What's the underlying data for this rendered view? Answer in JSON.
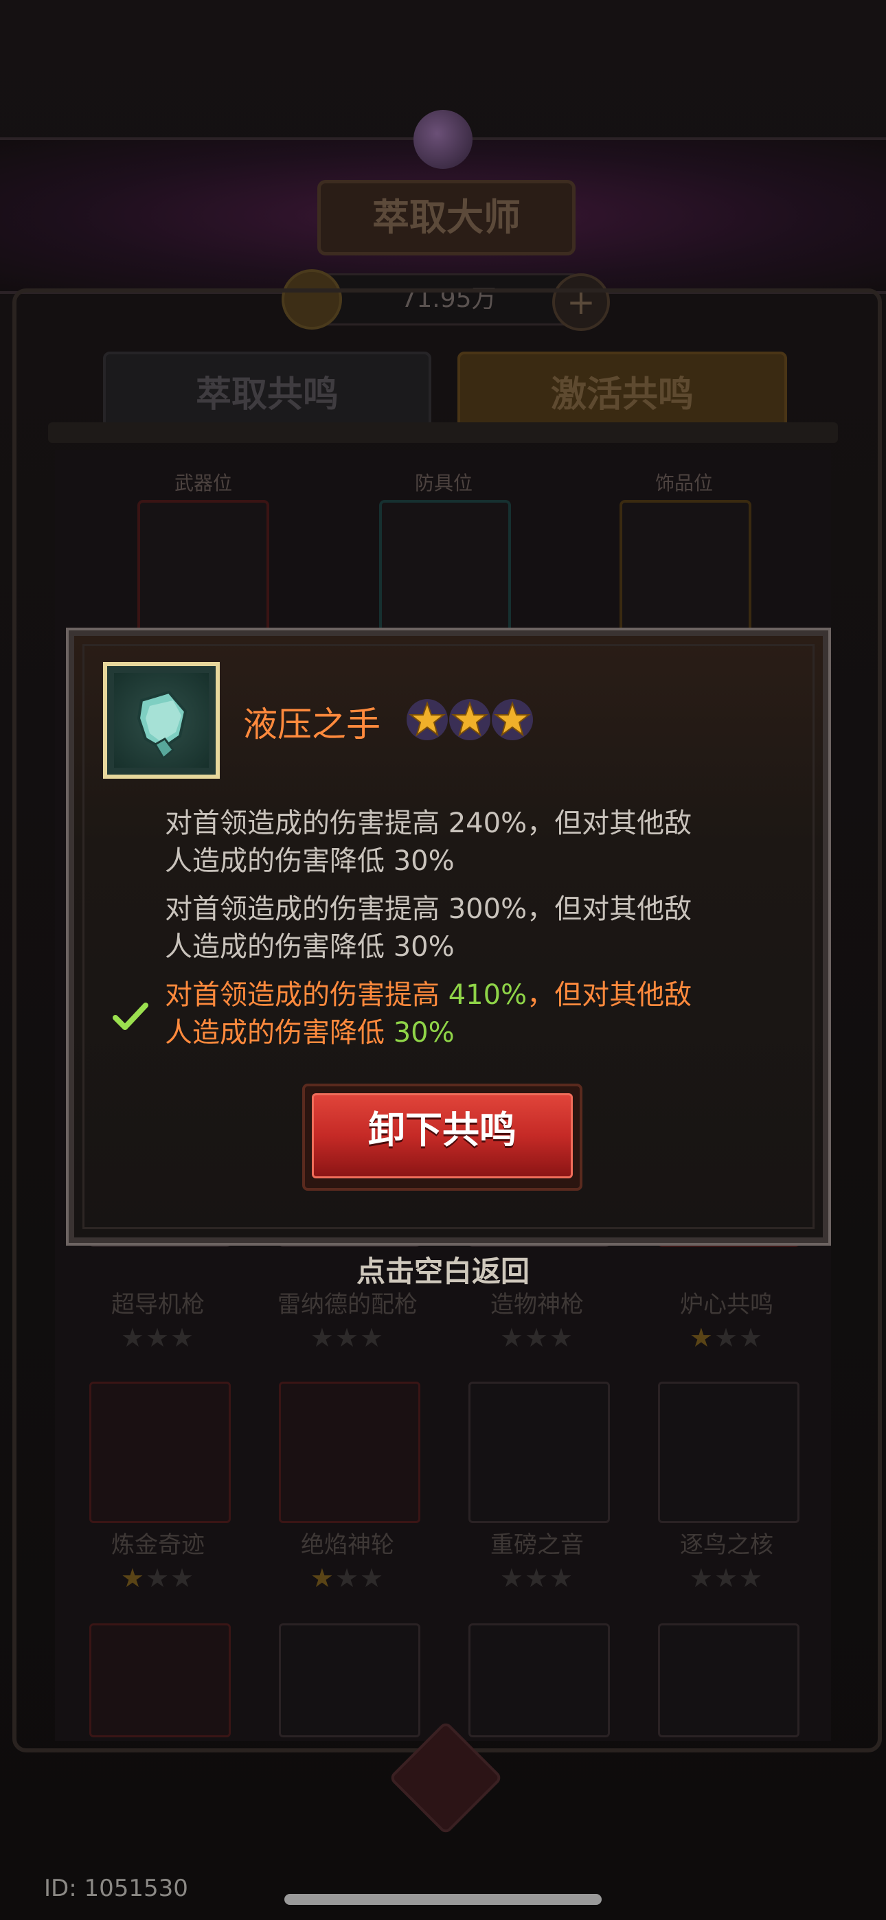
{
  "header": {
    "title": "萃取大师",
    "currency_amount": "71.95万"
  },
  "tabs": [
    {
      "label": "萃取共鸣"
    },
    {
      "label": "激活共鸣"
    }
  ],
  "slots": [
    {
      "label": "武器位"
    },
    {
      "label": "防具位"
    },
    {
      "label": "饰品位"
    }
  ],
  "items": [
    {
      "name": "超导机枪",
      "stars": 0
    },
    {
      "name": "雷纳德的配枪",
      "stars": 0
    },
    {
      "name": "造物神枪",
      "stars": 0
    },
    {
      "name": "炉心共鸣",
      "stars": 1
    },
    {
      "name": "炼金奇迹",
      "stars": 1
    },
    {
      "name": "绝焰神轮",
      "stars": 1
    },
    {
      "name": "重磅之音",
      "stars": 0
    },
    {
      "name": "逐鸟之核",
      "stars": 0
    }
  ],
  "modal": {
    "item_name": "液压之手",
    "item_stars": 3,
    "effects": [
      {
        "prefix": "对首领造成的伤害提高 ",
        "boost": "240%",
        "middle": "，但对其他敌",
        "line2": "人造成的伤害降低 ",
        "penalty": "30%",
        "active": false
      },
      {
        "prefix": "对首领造成的伤害提高 ",
        "boost": "300%",
        "middle": "，但对其他敌",
        "line2": "人造成的伤害降低 ",
        "penalty": "30%",
        "active": false
      },
      {
        "prefix": "对首领造成的伤害提高 ",
        "boost": "410%",
        "middle": "，但对其他敌",
        "line2": "人造成的伤害降低 ",
        "penalty": "30%",
        "active": true
      }
    ],
    "unequip_button": "卸下共鸣"
  },
  "back_hint": "点击空白返回",
  "user_id": "ID: 1051530",
  "colors": {
    "accent_orange": "#ff8a3d",
    "highlight_green": "#8fd448",
    "button_red": "#c52a26",
    "star_gold": "#f0b02a"
  }
}
